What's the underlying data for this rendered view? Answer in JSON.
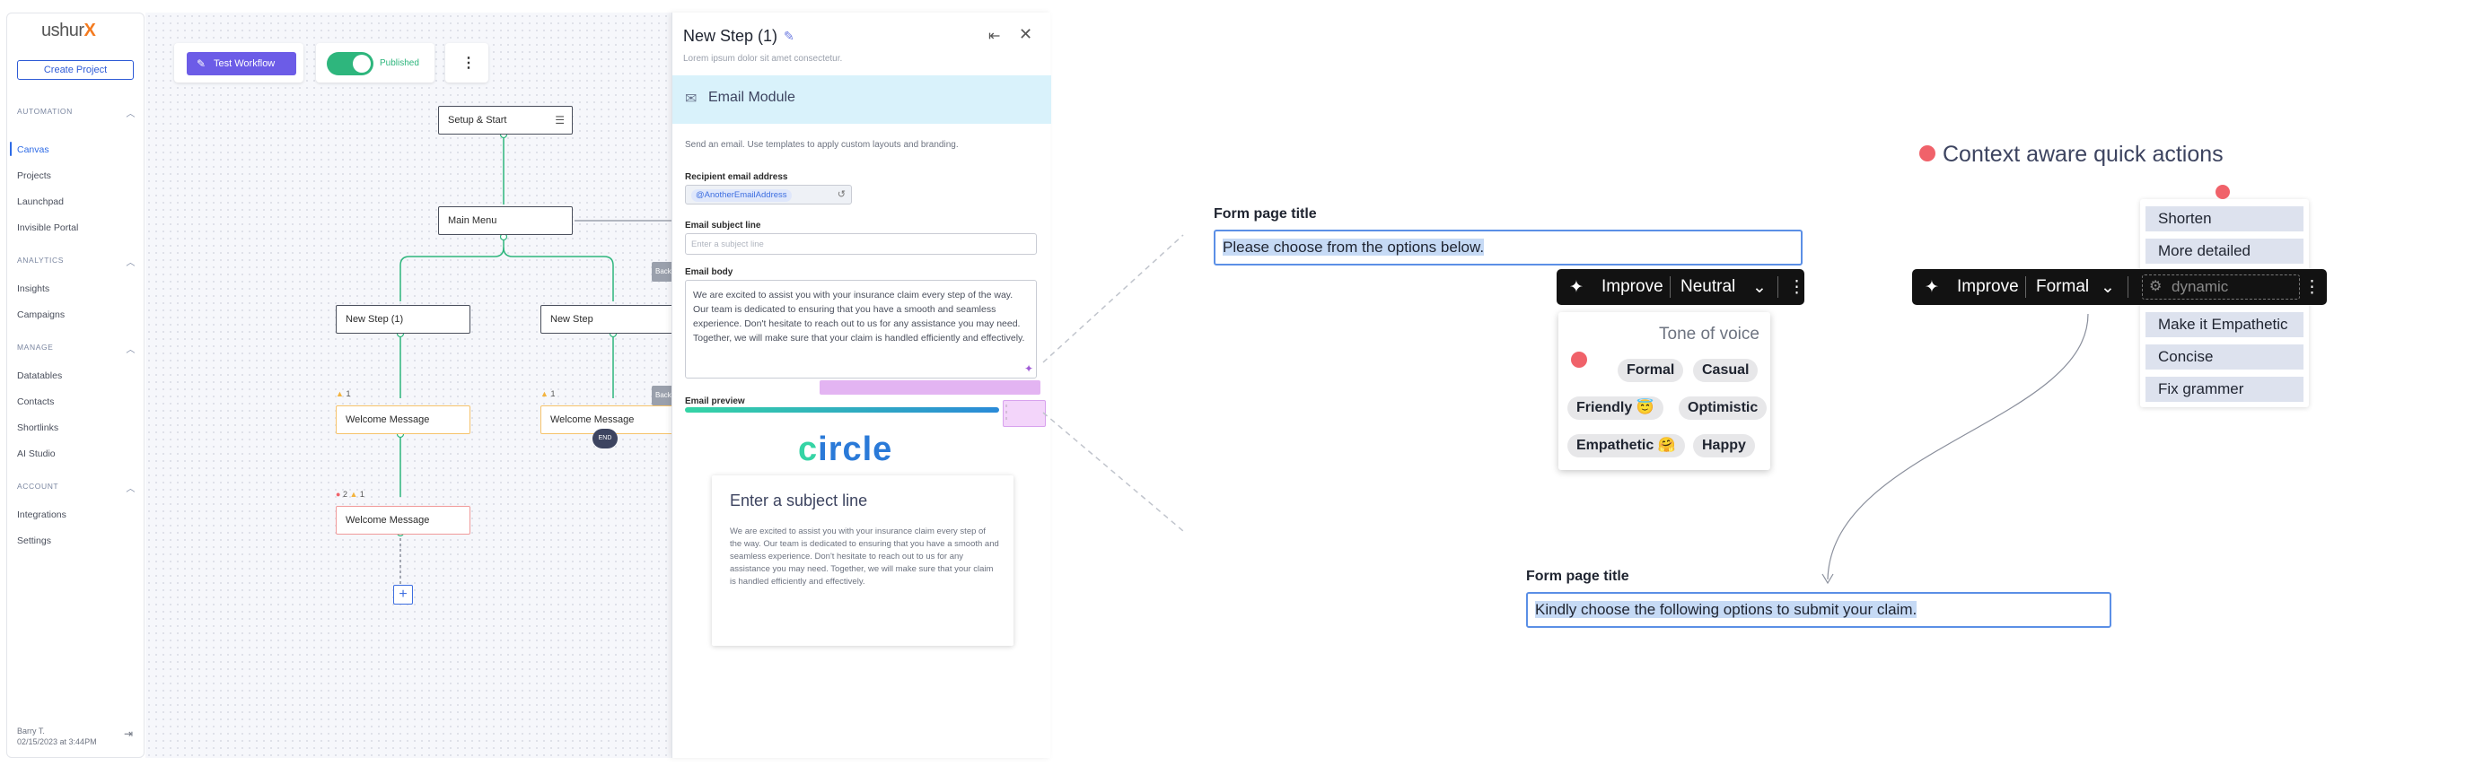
{
  "logo": {
    "text": "ushur",
    "mark": "X"
  },
  "sidebar": {
    "create_project": "Create Project",
    "sections": [
      {
        "title": "AUTOMATION",
        "items": [
          "Canvas",
          "Projects",
          "Launchpad",
          "Invisible Portal"
        ]
      },
      {
        "title": "ANALYTICS",
        "items": [
          "Insights",
          "Campaigns"
        ]
      },
      {
        "title": "MANAGE",
        "items": [
          "Datatables",
          "Contacts",
          "Shortlinks",
          "AI Studio"
        ]
      },
      {
        "title": "ACCOUNT",
        "items": [
          "Integrations",
          "Settings"
        ]
      }
    ],
    "active_item": "Canvas",
    "user_name": "Barry T.",
    "user_time": "02/15/2023 at 3:44PM"
  },
  "toolbar": {
    "test_workflow": "Test Workflow",
    "published": "Published",
    "more": "⋮"
  },
  "canvas": {
    "nodes": {
      "setup": "Setup & Start",
      "main_menu": "Main Menu",
      "new_step_1": "New Step (1)",
      "new_step": "New Step",
      "welcome_1": "Welcome Message",
      "welcome_2": "Welcome Message",
      "welcome_3": "Welcome Message"
    },
    "warn_count_1": "1",
    "warn_count_2": "1",
    "err_count": "2",
    "warn_count_3": "1",
    "end": "END",
    "grey_tag_1": "Back",
    "grey_tag_2": "Back",
    "add": "+"
  },
  "panel": {
    "title": "New Step (1)",
    "subtitle": "Lorem ipsum dolor sit amet consectetur.",
    "module": "Email Module",
    "description": "Send an email. Use templates to apply custom layouts and branding.",
    "recipient_label": "Recipient email address",
    "recipient_value": "@AnotherEmailAddress",
    "subject_label": "Email subject line",
    "subject_placeholder": "Enter a subject line",
    "body_label": "Email body",
    "body_text": "We are excited to assist you with your insurance claim every step of the way. Our team is dedicated to ensuring that you have a smooth and seamless experience. Don't hesitate to reach out to us for any assistance you may need. Together, we will make sure that your claim is handled efficiently and effectively.",
    "preview_label": "Email preview",
    "preview_logo": "circle",
    "preview_heading": "Enter a subject line",
    "preview_text": "We are excited to assist you with your insurance claim every step of the way. Our team is dedicated to ensuring that you have a smooth and seamless experience. Don't hesitate to reach out to us for any assistance you may need. Together, we will make sure that your claim is handled efficiently and effectively."
  },
  "demo": {
    "form_title_1": "Form page title",
    "input_1": "Please choose from the options below.",
    "tb1": {
      "improve": "Improve",
      "tone": "Neutral"
    },
    "tone_title": "Tone of voice",
    "tones": [
      "Formal",
      "Casual",
      "Friendly 😇",
      "Optimistic",
      "Empathetic 🤗",
      "Happy"
    ],
    "qa_title": "Context aware quick actions",
    "suggestions_top": [
      "Shorten",
      "More detailed"
    ],
    "suggestions_bottom": [
      "Make it Empathetic",
      "Concise",
      "Fix grammer"
    ],
    "tb2": {
      "improve": "Improve",
      "tone": "Formal",
      "dynamic": "dynamic"
    },
    "form_title_2": "Form page title",
    "input_2": "Kindly choose the following options to submit your claim."
  },
  "colors": {
    "accent": "#2e6be6",
    "purple": "#6c5ce7",
    "green": "#2eb67d",
    "module_bg": "#d9f2fb",
    "dot": "#f0626a"
  }
}
